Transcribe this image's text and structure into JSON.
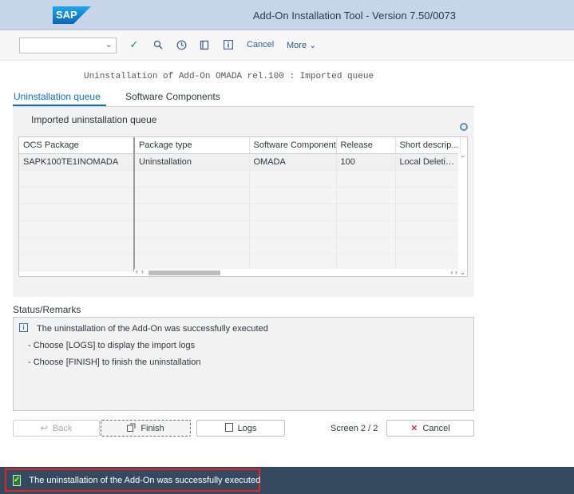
{
  "titlebar": {
    "logo": "SAP",
    "title": "Add-On Installation Tool - Version 7.50/0073"
  },
  "toolbar": {
    "select_value": "",
    "icons": [
      "checkmark-icon",
      "zoom-icon",
      "clock-icon",
      "book-icon",
      "info-icon"
    ],
    "cancel_label": "Cancel",
    "more_label": "More"
  },
  "heading": "Uninstallation of Add-On OMADA rel.100 : Imported queue",
  "tabs": [
    {
      "label": "Uninstallation queue",
      "active": true
    },
    {
      "label": "Software Components",
      "active": false
    }
  ],
  "panel": {
    "title": "Imported uninstallation queue",
    "columns": [
      "OCS Package",
      "Package type",
      "Software Component",
      "Release",
      "Short descrip..."
    ],
    "rows": [
      [
        "SAPK100TE1INOMADA",
        "Uninstallation",
        "OMADA",
        "100",
        "Local Deletio..."
      ]
    ]
  },
  "status": {
    "label": "Status/Remarks",
    "lines": [
      "The uninstallation of the Add-On was successfully executed",
      "- Choose [LOGS] to display the import logs",
      "- Choose [FINISH] to finish the uninstallation"
    ]
  },
  "buttons": {
    "back": "Back",
    "finish": "Finish",
    "logs": "Logs",
    "screen": "Screen 2 / 2",
    "cancel": "Cancel"
  },
  "message": {
    "text": "The uninstallation of the Add-On was successfully executed",
    "status_color": "#2b7c2b"
  },
  "colors": {
    "titlebar": "#c6d6e8",
    "accent": "#0a6ed1",
    "footer": "#354a5f",
    "highlight": "#e0262b"
  }
}
